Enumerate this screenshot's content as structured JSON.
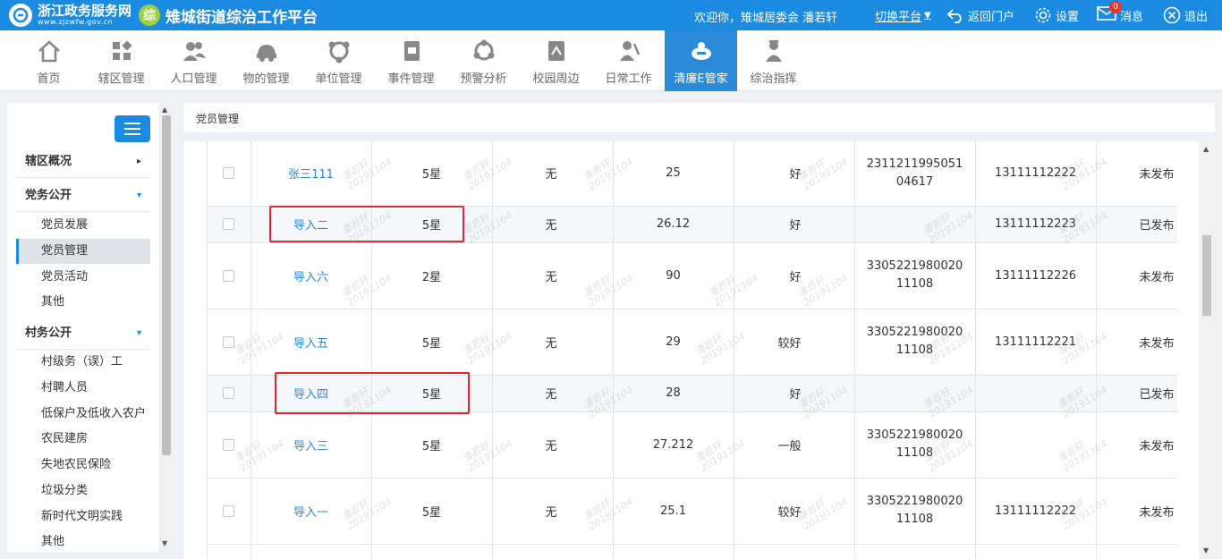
{
  "header": {
    "portal_name": "浙江政务服务网",
    "portal_url": "www.zjzwfw.gov.cn",
    "platform_logo_char": "综",
    "platform_title": "雉城街道综治工作平台",
    "welcome": "欢迎你，雉城居委会 潘若轩",
    "switch_label": "切换平台",
    "back_label": "返回门户",
    "settings_label": "设置",
    "messages_label": "消息",
    "messages_count": "0",
    "logout_label": "退出",
    "accent": "#1a8be0"
  },
  "nav": [
    {
      "label": "首页",
      "icon": "home-icon"
    },
    {
      "label": "辖区管理",
      "icon": "grid-icon"
    },
    {
      "label": "人口管理",
      "icon": "people-icon"
    },
    {
      "label": "物的管理",
      "icon": "car-icon"
    },
    {
      "label": "单位管理",
      "icon": "building-icon"
    },
    {
      "label": "事件管理",
      "icon": "document-icon"
    },
    {
      "label": "预警分析",
      "icon": "alert-icon"
    },
    {
      "label": "校园周边",
      "icon": "school-icon"
    },
    {
      "label": "日常工作",
      "icon": "worker-icon"
    },
    {
      "label": "清廉E管家",
      "icon": "clean-icon",
      "active": true
    },
    {
      "label": "综治指挥",
      "icon": "command-icon"
    }
  ],
  "sidebar": {
    "groups": [
      {
        "label": "辖区概况",
        "arrow": "▸"
      },
      {
        "label": "党务公开",
        "arrow": "▾"
      },
      {
        "label": "村务公开",
        "arrow": "▾"
      }
    ],
    "party_items": [
      "党员发展",
      "党员管理",
      "党员活动",
      "其他"
    ],
    "village_items": [
      "村级务（误）工",
      "村聘人员",
      "低保户及低收入农户",
      "农民建房",
      "失地农民保险",
      "垃圾分类",
      "新时代文明实践",
      "其他"
    ]
  },
  "content": {
    "title": "党员管理",
    "watermark_name": "潘若轩",
    "watermark_date": "20191104",
    "rows": [
      {
        "name": "张三111",
        "star": "5星",
        "none": "无",
        "num": "25",
        "eval": "好",
        "id": "231121199505104617",
        "phone": "13111112222",
        "status": "未发布"
      },
      {
        "name": "导入二",
        "star": "5星",
        "none": "无",
        "num": "26.12",
        "eval": "好",
        "id": "",
        "phone": "13111112223",
        "status": "已发布"
      },
      {
        "name": "导入六",
        "star": "2星",
        "none": "无",
        "num": "90",
        "eval": "好",
        "id": "330522198002011108",
        "phone": "13111112226",
        "status": "未发布"
      },
      {
        "name": "导入五",
        "star": "5星",
        "none": "无",
        "num": "29",
        "eval": "较好",
        "id": "330522198002011108",
        "phone": "13111112221",
        "status": "未发布"
      },
      {
        "name": "导入四",
        "star": "5星",
        "none": "无",
        "num": "28",
        "eval": "好",
        "id": "",
        "phone": "",
        "status": "已发布"
      },
      {
        "name": "导入三",
        "star": "5星",
        "none": "无",
        "num": "27.212",
        "eval": "一般",
        "id": "330522198002011108",
        "phone": "",
        "status": "未发布"
      },
      {
        "name": "导入一",
        "star": "5星",
        "none": "无",
        "num": "25.1",
        "eval": "较好",
        "id": "330522198002011108",
        "phone": "13111112222",
        "status": "未发布"
      },
      {
        "name": "",
        "star": "",
        "none": "",
        "num": "",
        "eval": "",
        "id": "",
        "phone": "",
        "status": ""
      }
    ]
  }
}
